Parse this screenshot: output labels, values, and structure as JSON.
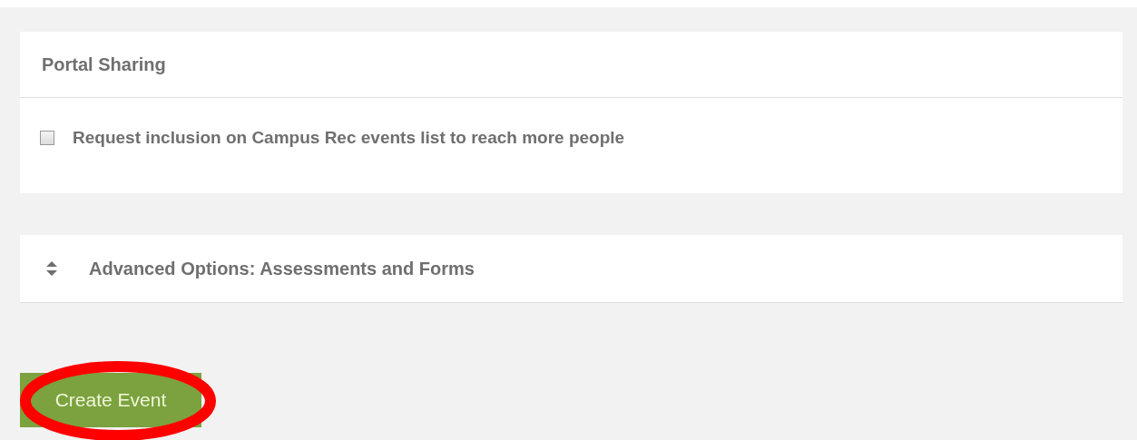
{
  "sections": [
    {
      "kind": "panel",
      "title": "Portal Sharing",
      "options": [
        {
          "label": "Request inclusion on Campus Rec events list to reach more people",
          "checked": false
        }
      ]
    },
    {
      "kind": "collapsible",
      "title": "Advanced Options: Assessments and Forms"
    }
  ],
  "submit_button": {
    "label": "Create Event",
    "highlighted": true
  }
}
